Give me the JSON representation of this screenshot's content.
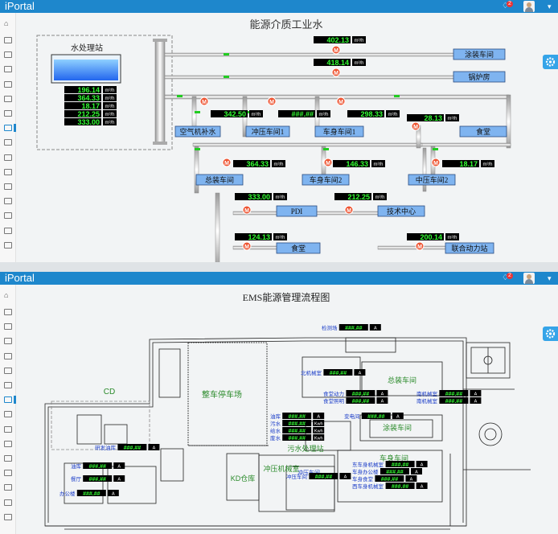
{
  "app": {
    "brand": "iPortal",
    "notification_count": "2",
    "bell_icon": "bell-icon",
    "user_icon": "user-avatar-icon",
    "menu_icon": "caret-down-icon",
    "settings_icon": "gear-icon",
    "home_icon": "home-icon",
    "folder_icon": "folder-icon",
    "accent": "#1e87cc"
  },
  "water": {
    "title": "能源介质工业水",
    "station_label": "水处理站",
    "station_readings": [
      {
        "value": "196.14",
        "unit": "m³/h"
      },
      {
        "value": "364.33",
        "unit": "m³/h"
      },
      {
        "value": "18.17",
        "unit": "m³/h"
      },
      {
        "value": "212.25",
        "unit": "m³/h"
      },
      {
        "value": "333.00",
        "unit": "m³/h"
      }
    ],
    "destinations": {
      "paint_shop": "涂装车间",
      "boiler_room": "锅炉房",
      "air_compressor": "空气机补水",
      "press_shop1": "冲压车间1",
      "body_shop1": "车身车间1",
      "canteen1": "食堂",
      "assembly": "总装车间",
      "body_shop2": "车身车间2",
      "press_shop2": "中压车间2",
      "pdi": "PDI",
      "tech_center": "技术中心",
      "canteen2": "食堂",
      "power_station": "联合动力站"
    },
    "meters": {
      "paint_shop": {
        "value": "402.13",
        "unit": "m³/h"
      },
      "boiler_room": {
        "value": "418.14",
        "unit": "m³/h"
      },
      "air_compressor": {
        "value": "342.50",
        "unit": "m³/h"
      },
      "press_shop1": {
        "value": "###.##",
        "unit": "m³/h"
      },
      "body_shop1": {
        "value": "298.33",
        "unit": "m³/h"
      },
      "canteen1": {
        "value": "28.13",
        "unit": "m³/h"
      },
      "assembly": {
        "value": "364.33",
        "unit": "m³/h"
      },
      "body_shop2": {
        "value": "146.33",
        "unit": "m³/h"
      },
      "press_shop2": {
        "value": "18.17",
        "unit": "m³/h"
      },
      "pdi": {
        "value": "333.00",
        "unit": "m³/h"
      },
      "tech_center": {
        "value": "212.25",
        "unit": "m³/h"
      },
      "canteen2": {
        "value": "124.13",
        "unit": "m³/h"
      },
      "power_station": {
        "value": "200.14",
        "unit": "m³/h"
      }
    },
    "meter_symbol": "M"
  },
  "ems": {
    "title": "EMS能源管理流程图",
    "areas": {
      "cd": "CD",
      "parking": "整车停车场",
      "assembly": "总装车间",
      "paint": "涂装车间",
      "water_treatment": "污水处理站",
      "body": "车身车间",
      "press_building": "冲压机械室",
      "kd": "KD仓库",
      "press_shop": "冲压车间"
    },
    "readouts": [
      {
        "label": "检测场",
        "value": "###.##",
        "unit": "A"
      },
      {
        "label": "北机械室",
        "value": "###.##",
        "unit": "A"
      },
      {
        "label": "食堂动力",
        "value": "###.##",
        "unit": "A"
      },
      {
        "label": "食堂照明",
        "value": "###.##",
        "unit": "A"
      },
      {
        "label": "南机械室",
        "value": "###.##",
        "unit": "A"
      },
      {
        "label": "南机械室",
        "value": "###.##",
        "unit": "A"
      },
      {
        "label": "油库",
        "value": "###.##",
        "unit": "A"
      },
      {
        "label": "污水",
        "value": "###.##",
        "unit": "Kwh"
      },
      {
        "label": "给水",
        "value": "###.##",
        "unit": "Kwh"
      },
      {
        "label": "废水",
        "value": "###.##",
        "unit": "Kwh"
      },
      {
        "label": "变电间",
        "value": "###.##",
        "unit": "A"
      },
      {
        "label": "研发油库",
        "value": "###.##",
        "unit": "A"
      },
      {
        "label": "油库",
        "value": "###.##",
        "unit": "A"
      },
      {
        "label": "餐厅",
        "value": "###.##",
        "unit": "A"
      },
      {
        "label": "办公楼",
        "value": "###.##",
        "unit": "A"
      },
      {
        "label": "冲压车间",
        "value": "###.##",
        "unit": "A"
      },
      {
        "label": "东车身机械室",
        "value": "###.##",
        "unit": "A"
      },
      {
        "label": "车身办公楼",
        "value": "###.##",
        "unit": "A"
      },
      {
        "label": "车身食堂",
        "value": "###.##",
        "unit": "A"
      },
      {
        "label": "西车身机械室",
        "value": "###.##",
        "unit": "A"
      }
    ]
  }
}
